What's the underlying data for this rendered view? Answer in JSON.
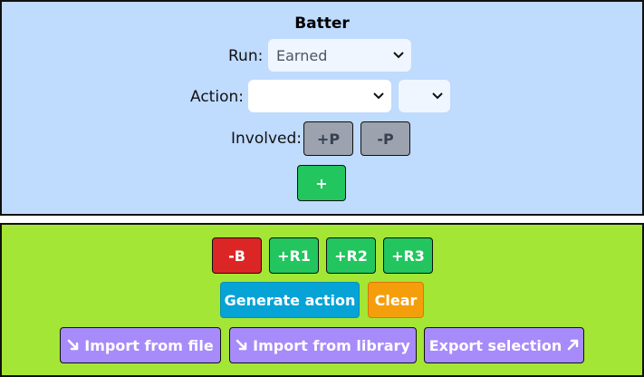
{
  "batter_panel": {
    "title": "Batter",
    "run_label": "Run:",
    "run_value": "Earned",
    "action_label": "Action:",
    "action_value": "",
    "action_sub_value": "",
    "involved_label": "Involved:",
    "add_player_label": "+P",
    "remove_player_label": "-P",
    "add_label": "+"
  },
  "actions_panel": {
    "remove_batter_label": "-B",
    "runner_buttons": [
      "+R1",
      "+R2",
      "+R3"
    ],
    "generate_label": "Generate action",
    "clear_label": "Clear",
    "import_file_label": "Import from file",
    "import_library_label": "Import from library",
    "export_label": "Export selection"
  },
  "colors": {
    "batter_bg": "#bfdbfe",
    "actions_bg": "#a3e635",
    "green": "#22c55e",
    "red": "#dc2626",
    "blue": "#06a3d6",
    "orange": "#f59e0b",
    "purple": "#a78bfa",
    "gray": "#9ca3af"
  },
  "icons": {
    "import_file": "arrow-down-right-icon",
    "import_library": "arrow-down-right-icon",
    "export": "arrow-up-right-icon",
    "select_chevron": "chevron-down-icon"
  }
}
